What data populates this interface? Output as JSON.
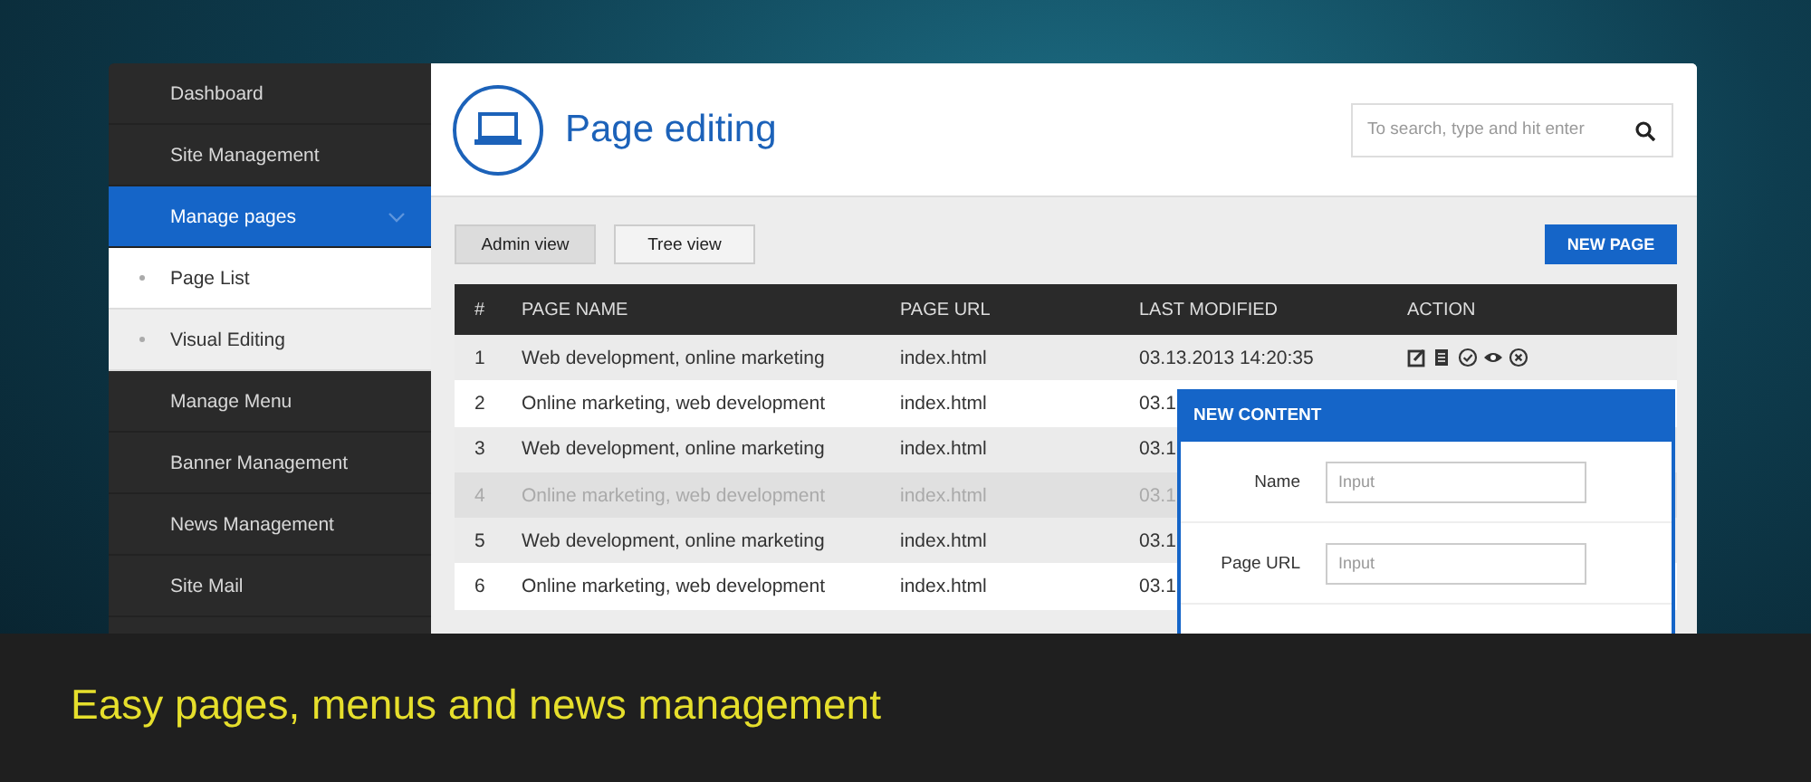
{
  "sidebar": {
    "items": [
      {
        "label": "Dashboard",
        "selected": false
      },
      {
        "label": "Site Management",
        "selected": false
      },
      {
        "label": "Manage pages",
        "selected": true,
        "expanded": true,
        "children": [
          {
            "label": "Page List",
            "selected": true
          },
          {
            "label": "Visual Editing",
            "selected": false
          }
        ]
      },
      {
        "label": "Manage Menu",
        "selected": false
      },
      {
        "label": "Banner Management",
        "selected": false
      },
      {
        "label": "News Management",
        "selected": false
      },
      {
        "label": "Site Mail",
        "selected": false
      }
    ]
  },
  "header": {
    "title": "Page editing",
    "search": {
      "placeholder": "To search, type and hit enter"
    }
  },
  "toolbar": {
    "views": [
      {
        "label": "Admin view",
        "selected": true
      },
      {
        "label": "Tree view",
        "selected": false
      }
    ],
    "new_page_button": "NEW PAGE"
  },
  "table": {
    "columns": [
      "#",
      "PAGE NAME",
      "PAGE URL",
      "LAST MODIFIED",
      "ACTION"
    ],
    "rows": [
      {
        "cells": [
          "1",
          "Web development, online marketing",
          "index.html",
          "03.13.2013  14:20:35"
        ],
        "disabled": false,
        "actions": true
      },
      {
        "cells": [
          "2",
          "Online marketing, web development",
          "index.html",
          "03.1"
        ],
        "disabled": false
      },
      {
        "cells": [
          "3",
          "Web development, online marketing",
          "index.html",
          "03.1"
        ],
        "disabled": false
      },
      {
        "cells": [
          "4",
          "Online marketing, web development",
          "index.html",
          "03.1"
        ],
        "disabled": true
      },
      {
        "cells": [
          "5",
          "Web development, online marketing",
          "index.html",
          "03.1"
        ],
        "disabled": false
      },
      {
        "cells": [
          "6",
          "Online marketing, web development",
          "index.html",
          "03.1"
        ],
        "disabled": false
      }
    ]
  },
  "modal": {
    "title": "NEW CONTENT",
    "fields": [
      {
        "label": "Name",
        "placeholder": "Input",
        "kind": "text"
      },
      {
        "label": "Page URL",
        "placeholder": "Input",
        "kind": "text"
      }
    ]
  },
  "caption": "Easy pages, menus and news management"
}
